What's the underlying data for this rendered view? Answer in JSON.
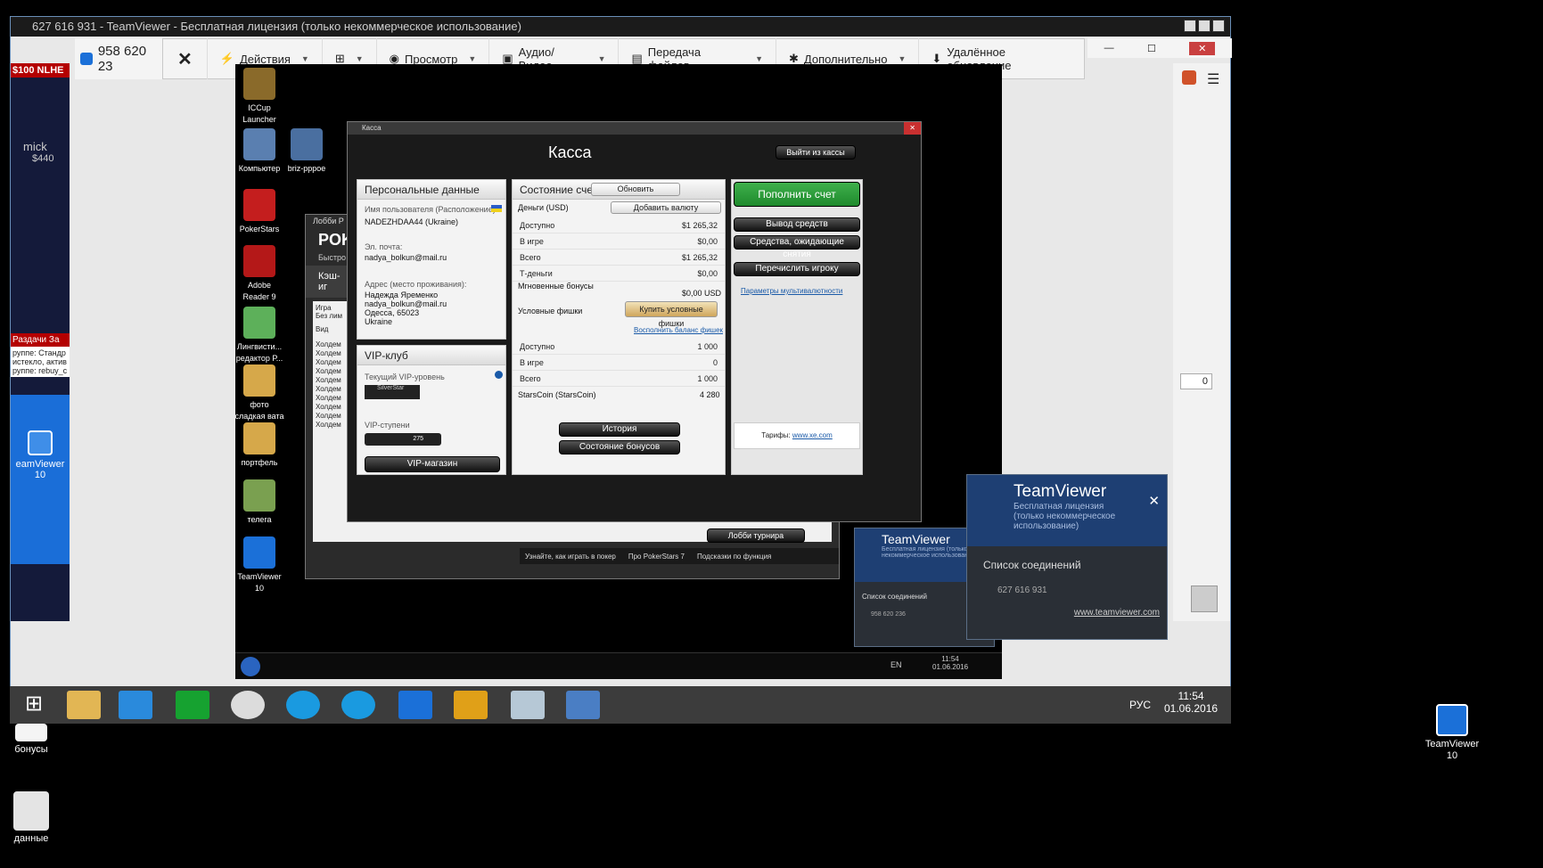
{
  "window": {
    "title": "627 616 931 - TeamViewer - Бесплатная лицензия (только некоммерческое использование)",
    "session_tab": "958 620 23"
  },
  "toolbar": {
    "actions": "Действия",
    "view": "Просмотр",
    "audio_video": "Аудио/Видео",
    "file_transfer": "Передача файлов",
    "extra": "Дополнительно",
    "remote_update": "Удалённое обновление"
  },
  "host_desktop": {
    "icons": [
      "TeamViewer\n10",
      "бонусы",
      "данные"
    ],
    "tv_icon_left": "eamViewer\n10"
  },
  "remote_icons": [
    {
      "label": "ICCup\nLauncher"
    },
    {
      "label": "Компьютер"
    },
    {
      "label": "briz-pppoe"
    },
    {
      "label": "PokerStars"
    },
    {
      "label": "Adobe\nReader 9"
    },
    {
      "label": "Лингвисти...\nредактор Р..."
    },
    {
      "label": "фото\nсладкая вата"
    },
    {
      "label": "портфель"
    },
    {
      "label": "телега"
    },
    {
      "label": "TeamViewer\n10"
    }
  ],
  "kassa": {
    "window_title": "Касса",
    "header": "Касса",
    "exit": "Выйти из кассы",
    "personal": {
      "title": "Персональные данные",
      "username_label": "Имя пользователя (Расположение):",
      "username": "NADEZHDAA44 (Ukraine)",
      "email_label": "Эл. почта:",
      "email": "nadya_bolkun@mail.ru",
      "address_label": "Адрес (место проживания):",
      "address": [
        "Надежда Яременко",
        "nadya_bolkun@mail.ru",
        "Одесса, 65023",
        "Ukraine"
      ]
    },
    "vip": {
      "title": "VIP-клуб",
      "level_label": "Текущий VIP-уровень",
      "level": "SilverStar",
      "steps_label": "VIP-ступени",
      "steps_value": "275",
      "shop": "VIP-магазин"
    },
    "account": {
      "title": "Состояние счета",
      "refresh": "Обновить",
      "money": "Деньги (USD)",
      "add_currency": "Добавить валюту",
      "rows": [
        {
          "label": "Доступно",
          "value": "$1 265,32"
        },
        {
          "label": "В игре",
          "value": "$0,00"
        },
        {
          "label": "Всего",
          "value": "$1 265,32"
        },
        {
          "label": "Т-деньги",
          "value": "$0,00"
        }
      ],
      "instant_bonus": "Мгновенные бонусы",
      "instant_value": "$0,00 USD",
      "cond_chips": "Условные фишки",
      "buy_chips": "Купить условные фишки",
      "fill_balance": "Восполнить баланс фишек",
      "chip_rows": [
        {
          "label": "Доступно",
          "value": "1 000"
        },
        {
          "label": "В игре",
          "value": "0"
        },
        {
          "label": "Всего",
          "value": "1 000"
        }
      ],
      "starscoin": "StarsCoin (StarsCoin)",
      "starscoin_value": "4 280",
      "history": "История",
      "bonus_state": "Состояние бонусов"
    },
    "actions": {
      "deposit": "Пополнить счет",
      "withdraw": "Вывод средств",
      "pending": "Средства, ожидающие снятия",
      "transfer": "Перечислить игроку",
      "multicurrency": "Параметры мультивалютности",
      "rates_label": "Тарифы:",
      "rates_link": "www.xe.com"
    }
  },
  "lobby": {
    "title": "Лобби Р",
    "pok": "POK",
    "fast": "Быстро",
    "cash": "Кэш-иг",
    "game": "Игра",
    "no_limit": "Без лим",
    "view": "Вид",
    "rows": [
      "Холдем",
      "Холдем",
      "Холдем",
      "Холдем",
      "Холдем",
      "Холдем",
      "Холдем",
      "Холдем",
      "Холдем",
      "Холдем"
    ],
    "tournament_lobby": "Лобби турнира",
    "learn": "Узнайте, как играть в покер",
    "about": "Про PokerStars 7",
    "hints": "Подсказки по функция"
  },
  "left_strip": {
    "nlhe": "$100 NLHE",
    "mick": "mick",
    "amount": "$440",
    "tabs": "Раздачи За",
    "info1": "руппе: Стандр",
    "info2": "истекло, актив",
    "info3": "руппе: rebuy_c"
  },
  "tv_panel_big": {
    "brand": "TeamViewer",
    "license": "Бесплатная лицензия (только некоммерческое использование)",
    "connections": "Список соединений",
    "peer": "627 616 931",
    "site": "www.teamviewer.com"
  },
  "tv_panel_small": {
    "brand": "TeamViewer",
    "license": "Бесплатная лицензия (только некоммерческое использование)",
    "connections": "Список соединений",
    "peer": "958 620 236"
  },
  "remote_taskbar": {
    "lang": "EN",
    "time": "11:54",
    "date": "01.06.2016"
  },
  "host_taskbar": {
    "lang": "РУС",
    "time": "11:54",
    "date": "01.06.2016"
  },
  "right_sidebar": {
    "count": "0"
  },
  "colors": {
    "deposit_green": "#1e8a2c",
    "tv_blue": "#1e3f73",
    "link_blue": "#1a5aa8"
  }
}
